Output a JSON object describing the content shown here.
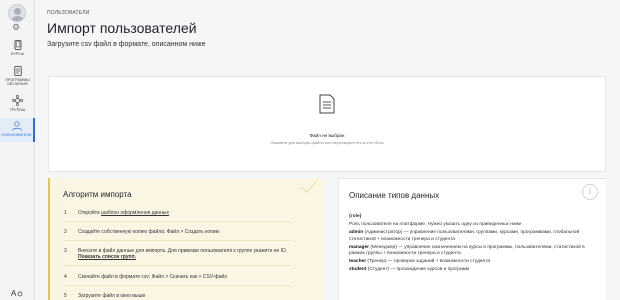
{
  "sidebar": {
    "items": [
      {
        "label": "Курсы",
        "icon": "phone-icon",
        "active": false
      },
      {
        "label": "Программы обучения",
        "icon": "document-list-icon",
        "active": false
      },
      {
        "label": "Группы",
        "icon": "group-nodes-icon",
        "active": false
      },
      {
        "label": "Пользователи",
        "icon": "users-icon",
        "active": true
      }
    ],
    "settings_glyph": "⚙",
    "bottom_glyph": "A"
  },
  "breadcrumb": "Пользователи",
  "page": {
    "title": "Импорт пользователей",
    "subtitle": "Загрузите csv файл в формате, описанном ниже"
  },
  "dropzone": {
    "title": "Файл не выбран",
    "hint": "Нажмите для выбора файла или перетащите его в этот блок",
    "icon": "file-document-icon"
  },
  "algorithm": {
    "title": "Алгоритм импорта",
    "steps": [
      {
        "num": "1",
        "text": "Откройте ",
        "link": "шаблон оформления данных",
        "after": ""
      },
      {
        "num": "2",
        "text": "Создайте собственную копию файла: Файл > Создать копию",
        "link": "",
        "after": ""
      },
      {
        "num": "3",
        "text": "Внесите в файл данные для импорта. Для привязки пользователя к группе укажите ее ID. ",
        "link": "Показать список групп.",
        "after": ""
      },
      {
        "num": "4",
        "text": "Скачайте файл в формате csv: Файл > Скачать как > CSV-файл",
        "link": "",
        "after": ""
      },
      {
        "num": "5",
        "text": "Загрузите файл в окно выше",
        "link": "",
        "after": ""
      }
    ]
  },
  "types": {
    "title": "Описание типов данных",
    "role_key": "{role}",
    "role_desc": "Роль пользователя на платформе. Нужно указать одну из приведенных ниже",
    "roles": [
      {
        "key": "admin",
        "name": " (Администратор)",
        "desc": " — управление пользователями, группами, курсами, программами, глобальной статистикой + возможности тренера и студента"
      },
      {
        "key": "manager",
        "name": " (Менеджер)",
        "desc": " — управление назначением на курсы и программы, пользователями, статистикой в рамках группы + возможности тренера и студента"
      },
      {
        "key": "teacher",
        "name": " (Тренер)",
        "desc": " — проверка заданий + возможности студента"
      },
      {
        "key": "student",
        "name": " (Студент)",
        "desc": " — прохождение курсов и программ"
      }
    ]
  },
  "colors": {
    "accent": "#2c6fd1",
    "algo_bg": "#fbf6e4",
    "algo_border": "#efc04a"
  }
}
